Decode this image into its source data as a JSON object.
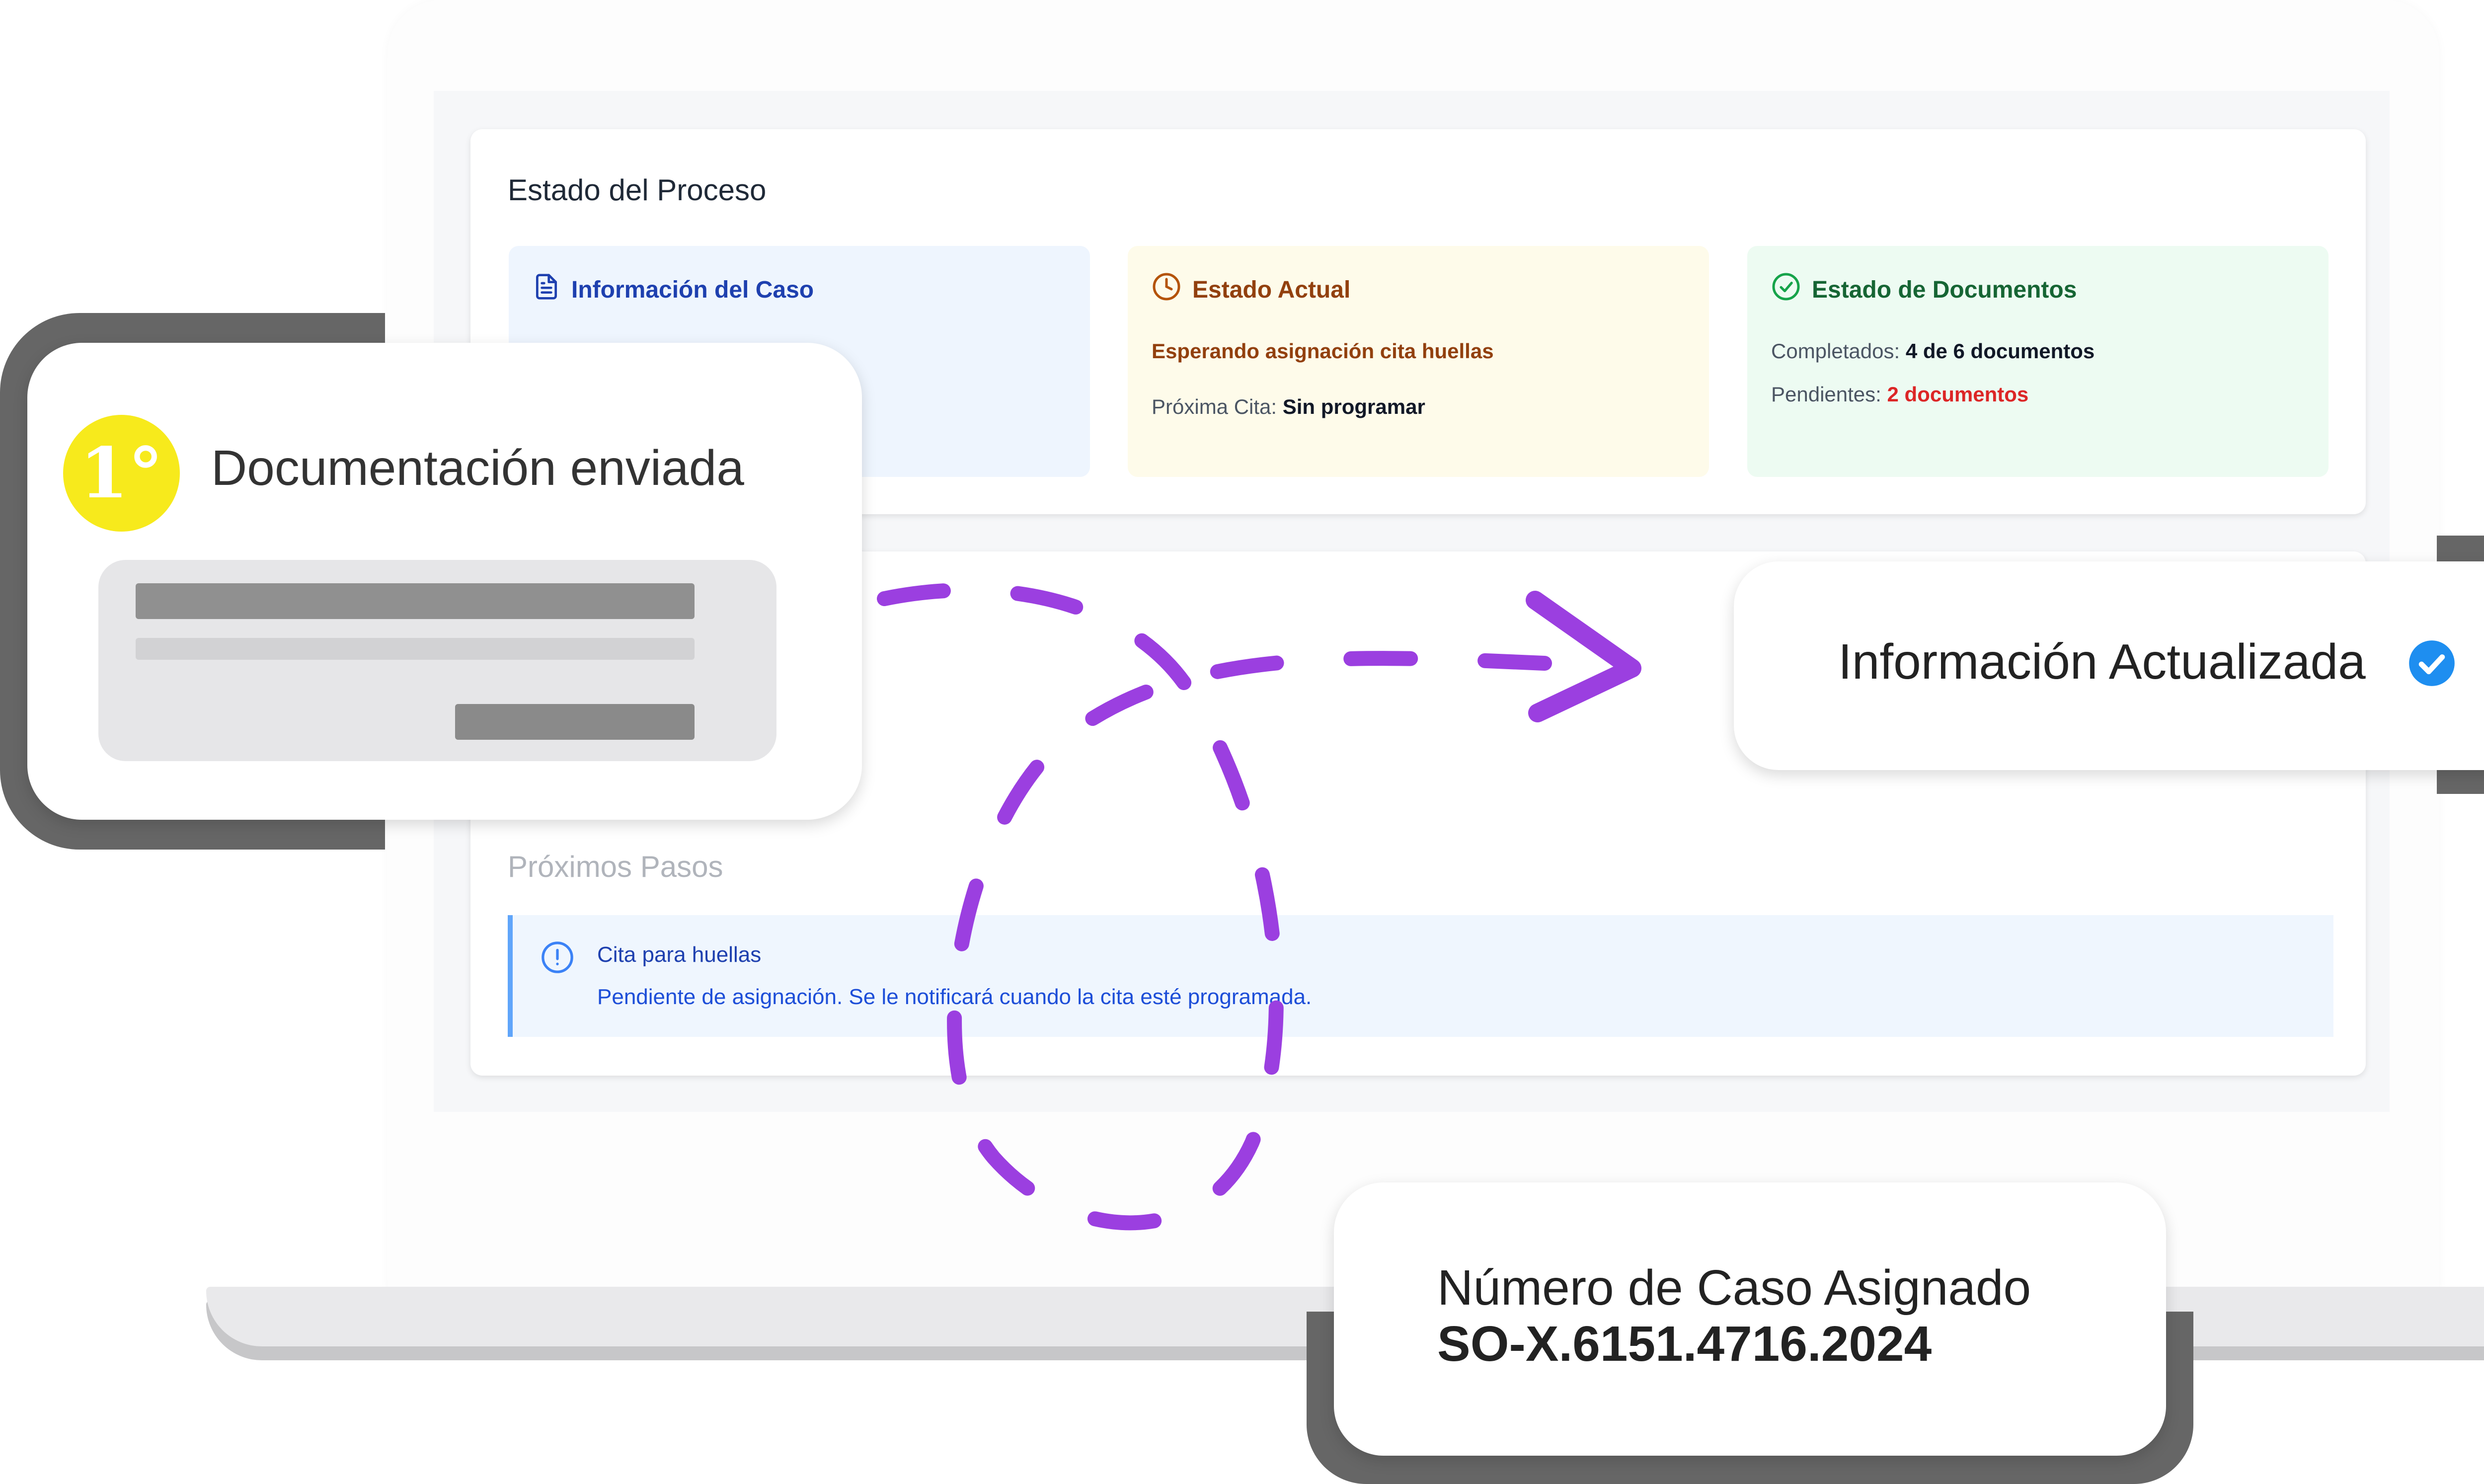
{
  "process": {
    "title": "Estado del Proceso",
    "case_info": {
      "title": "Información del Caso",
      "icon": "document-icon"
    },
    "current_state": {
      "title": "Estado Actual",
      "icon": "clock-icon",
      "status": "Esperando asignación cita huellas",
      "next_label": "Próxima Cita:",
      "next_value": "Sin programar"
    },
    "documents": {
      "title": "Estado de Documentos",
      "icon": "check-circle-icon",
      "completed_label": "Completados:",
      "completed_value": "4 de 6 documentos",
      "pending_label": "Pendientes:",
      "pending_value": "2 documentos"
    }
  },
  "next_steps": {
    "title": "Próximos Pasos",
    "item_title": "Cita para huellas",
    "item_text": "Pendiente de asignación. Se le notificará cuando la cita esté programada.",
    "icon": "info-circle-icon"
  },
  "callouts": {
    "step_badge": "1°",
    "doc_sent": "Documentación enviada",
    "info_updated": "Información Actualizada",
    "info_icon": "verified-check-icon",
    "case_label": "Número de Caso Asignado",
    "case_number": "SO-X.6151.4716.2024"
  },
  "colors": {
    "accent_purple": "#9b3fe0",
    "badge_yellow": "#f7ea1c",
    "blue": "#1e40af",
    "amber": "#92400e",
    "green": "#166534",
    "red": "#dc2626"
  }
}
